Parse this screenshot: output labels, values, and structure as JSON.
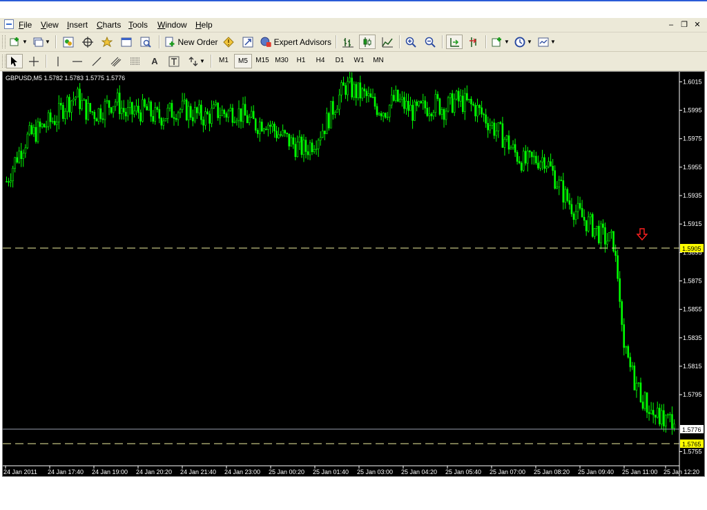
{
  "menu": {
    "items": [
      "File",
      "View",
      "Insert",
      "Charts",
      "Tools",
      "Window",
      "Help"
    ]
  },
  "toolbar": {
    "new_order_label": "New Order",
    "expert_advisors_label": "Expert Advisors"
  },
  "timeframes": [
    "M1",
    "M5",
    "M15",
    "M30",
    "H1",
    "H4",
    "D1",
    "W1",
    "MN"
  ],
  "active_timeframe": "M5",
  "chart": {
    "header": "GBPUSD,M5  1.5782 1.5783 1.5775 1.5776",
    "price_ticks": [
      "1.6015",
      "1.5995",
      "1.5975",
      "1.5955",
      "1.5935",
      "1.5915",
      "1.5895",
      "1.5875",
      "1.5855",
      "1.5835",
      "1.5815",
      "1.5795",
      "1.5755"
    ],
    "time_ticks": [
      "24 Jan 2011",
      "24 Jan 17:40",
      "24 Jan 19:00",
      "24 Jan 20:20",
      "24 Jan 21:40",
      "24 Jan 23:00",
      "25 Jan 00:20",
      "25 Jan 01:40",
      "25 Jan 03:00",
      "25 Jan 04:20",
      "25 Jan 05:40",
      "25 Jan 07:00",
      "25 Jan 08:20",
      "25 Jan 09:40",
      "25 Jan 11:00",
      "25 Jan 12:20"
    ],
    "level_upper": "1.5905",
    "level_lower": "1.5765",
    "current_price": "1.5776",
    "colors": {
      "background": "#000000",
      "candle": "#00ff00",
      "level_line": "#f0f0a0",
      "level_label_bg": "#ffff00",
      "arrow": "#ff2020",
      "bid_line": "#9aa0b0"
    }
  },
  "chart_data": {
    "type": "candlestick",
    "symbol": "GBPUSD",
    "timeframe": "M5",
    "ylim": [
      1.5745,
      1.6022
    ],
    "x_labels": [
      "24 Jan 2011",
      "24 Jan 17:40",
      "24 Jan 19:00",
      "24 Jan 20:20",
      "24 Jan 21:40",
      "24 Jan 23:00",
      "25 Jan 00:20",
      "25 Jan 01:40",
      "25 Jan 03:00",
      "25 Jan 04:20",
      "25 Jan 05:40",
      "25 Jan 07:00",
      "25 Jan 08:20",
      "25 Jan 09:40",
      "25 Jan 11:00",
      "25 Jan 12:20"
    ],
    "close_path": [
      1.5945,
      1.5962,
      1.5975,
      1.598,
      1.5985,
      1.599,
      1.6,
      1.6005,
      1.5995,
      1.5993,
      1.5998,
      1.6002,
      1.5992,
      1.5994,
      1.5995,
      1.599,
      1.5992,
      1.5996,
      1.5995,
      1.5992,
      1.599,
      1.5994,
      1.5993,
      1.5995,
      1.599,
      1.5985,
      1.5988,
      1.598,
      1.5975,
      1.597,
      1.5967,
      1.5975,
      1.5985,
      1.6,
      1.6012,
      1.6008,
      1.6005,
      1.5998,
      1.5995,
      1.6003,
      1.5998,
      1.5993,
      1.5997,
      1.6,
      1.5996,
      1.6002,
      1.6,
      1.5997,
      1.599,
      1.5982,
      1.5975,
      1.5965,
      1.5958,
      1.596,
      1.5962,
      1.5948,
      1.5935,
      1.5925,
      1.5918,
      1.5912,
      1.5905,
      1.5902,
      1.5825,
      1.5805,
      1.579,
      1.578,
      1.5777,
      1.5776
    ],
    "levels": [
      1.5905,
      1.5765
    ],
    "last_price": 1.5776
  }
}
